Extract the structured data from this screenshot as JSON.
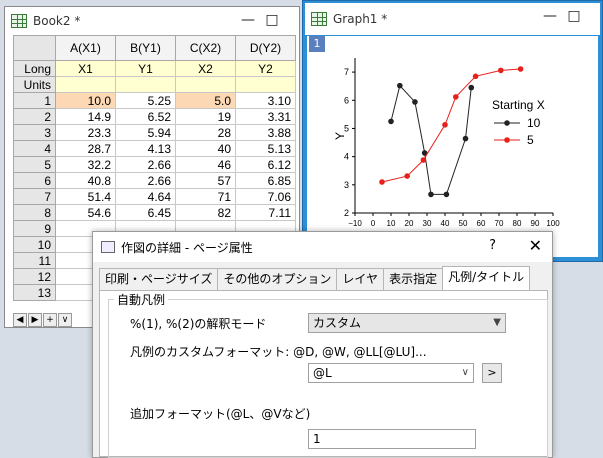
{
  "book": {
    "title": "Book2 *",
    "columns": [
      "A(X1)",
      "B(Y1)",
      "C(X2)",
      "D(Y2)"
    ],
    "long_label": "Long",
    "units_label": "Units",
    "long_names": [
      "X1",
      "Y1",
      "X2",
      "Y2"
    ],
    "rows": [
      {
        "num": "1",
        "cells": [
          "10.0",
          "5.25",
          "5.0",
          "3.10"
        ]
      },
      {
        "num": "2",
        "cells": [
          "14.9",
          "6.52",
          "19",
          "3.31"
        ]
      },
      {
        "num": "3",
        "cells": [
          "23.3",
          "5.94",
          "28",
          "3.88"
        ]
      },
      {
        "num": "4",
        "cells": [
          "28.7",
          "4.13",
          "40",
          "5.13"
        ]
      },
      {
        "num": "5",
        "cells": [
          "32.2",
          "2.66",
          "46",
          "6.12"
        ]
      },
      {
        "num": "6",
        "cells": [
          "40.8",
          "2.66",
          "57",
          "6.85"
        ]
      },
      {
        "num": "7",
        "cells": [
          "51.4",
          "4.64",
          "71",
          "7.06"
        ]
      },
      {
        "num": "8",
        "cells": [
          "54.6",
          "6.45",
          "82",
          "7.11"
        ]
      },
      {
        "num": "9",
        "cells": [
          "",
          "",
          "",
          ""
        ]
      },
      {
        "num": "10",
        "cells": [
          "",
          "",
          "",
          ""
        ]
      },
      {
        "num": "11",
        "cells": [
          "",
          "",
          "",
          ""
        ]
      },
      {
        "num": "12",
        "cells": [
          "",
          "",
          "",
          ""
        ]
      },
      {
        "num": "13",
        "cells": [
          "",
          "",
          "",
          ""
        ]
      }
    ],
    "nav_icons": [
      "prev-icon",
      "next-icon",
      "add-sheet-icon",
      "sheet-list-icon"
    ],
    "nav_glyphs": [
      "◀",
      "▶",
      "+",
      "∨"
    ]
  },
  "graph": {
    "title": "Graph1 *",
    "layer": "1",
    "ylabel": "Y",
    "legend_title": "Starting X",
    "legend_items": [
      "10",
      "5"
    ],
    "colors": {
      "series1": "#222222",
      "series2": "#e8201a"
    }
  },
  "chart_data": {
    "type": "line",
    "xlim": [
      -10,
      100
    ],
    "ylim": [
      2,
      7.5
    ],
    "xticks": [
      "−10",
      "0",
      "10",
      "20",
      "30",
      "40",
      "50",
      "60",
      "70",
      "80",
      "90",
      "100"
    ],
    "yticks": [
      "2",
      "3",
      "4",
      "5",
      "6",
      "7"
    ],
    "series": [
      {
        "name": "10",
        "x": [
          10.0,
          14.9,
          23.3,
          28.7,
          32.2,
          40.8,
          51.4,
          54.6
        ],
        "y": [
          5.25,
          6.52,
          5.94,
          4.13,
          2.66,
          2.66,
          4.64,
          6.45
        ]
      },
      {
        "name": "5",
        "x": [
          5.0,
          19,
          28,
          40,
          46,
          57,
          71,
          82
        ],
        "y": [
          3.1,
          3.31,
          3.88,
          5.13,
          6.12,
          6.85,
          7.06,
          7.11
        ]
      }
    ]
  },
  "dialog": {
    "title": "作図の詳細 - ページ属性",
    "help": "?",
    "close": "✕",
    "tabs": [
      "印刷・ページサイズ",
      "その他のオプション",
      "レイヤ",
      "表示指定",
      "凡例/タイトル"
    ],
    "group_label": "自動凡例",
    "mode_label": "%(1), %(2)の解釈モード",
    "mode_value": "カスタム",
    "custom_format_label": "凡例のカスタムフォーマット: @D, @W, @LL[@LU]...",
    "custom_format_value": "@L",
    "more_btn": ">",
    "extra_format_label": "追加フォーマット(@L、@Vなど)",
    "extra_format_value": "1"
  }
}
